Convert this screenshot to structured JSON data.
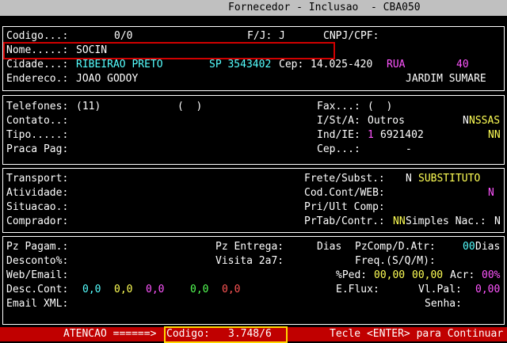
{
  "window": {
    "title": "Fornecedor - Inclusao  - CBA050"
  },
  "section1": {
    "codigo_label": "Codigo...:",
    "codigo_value": "0/0",
    "fj_label": "F/J:",
    "fj_value": "J",
    "cnpj_label": "CNPJ/CPF:",
    "nome_label": "Nome.....:",
    "nome_value": "SOCIN",
    "cidade_label": "Cidade...:",
    "cidade_value": "RIBEIRAO PRETO",
    "uf_code": "SP 3543402",
    "cep_label": "Cep:",
    "cep_value": "14.025-420",
    "logradouro_tipo": "RUA",
    "numero": "40",
    "endereco_label": "Endereco.:",
    "endereco_value": "JOAO GODOY",
    "bairro": "JARDIM SUMARE"
  },
  "section2": {
    "telefones_label": "Telefones:",
    "telefones_value": "(11)",
    "telefones_value2": "(  )",
    "fax_label": "Fax...:",
    "fax_value": "(  )",
    "contato_label": "Contato..:",
    "istA_label": "I/St/A:",
    "istA_value": "Outros",
    "flags_n": "N",
    "flags_nssas": "NSSAS",
    "tipo_label": "Tipo.....:",
    "indie_label": "Ind/IE:",
    "indie_ind": "1",
    "indie_value": "6921402",
    "flags_nn": "NN",
    "praca_label": "Praca Pag:",
    "cep2_label": "Cep...:",
    "cep2_value": "-"
  },
  "section3": {
    "transport_label": "Transport:",
    "frete_label": "Frete/Subst.:",
    "frete_n": "N",
    "frete_value": "SUBSTITUTO",
    "atividade_label": "Atividade:",
    "codcont_label": "Cod.Cont/WEB:",
    "codcont_value": "N",
    "situacao_label": "Situacao.:",
    "priult_label": "Pri/Ult Comp:",
    "comprador_label": "Comprador:",
    "prtab_label": "PrTab/Contr.:",
    "prtab_nn": "NN",
    "simples_label": "Simples Nac.:",
    "simples_value": "N"
  },
  "section4": {
    "pzpagam_label": "Pz Pagam.:",
    "pzentrega_label": "Pz Entrega:",
    "dias_label": "Dias",
    "pzcomp_label": "PzComp/D.Atr:",
    "pzcomp_value": "00",
    "dias2_label": "Dias",
    "desconto_label": "Desconto%:",
    "visita_label": "Visita 2a7:",
    "freq_label": "Freq.(S/Q/M):",
    "web_label": "Web/Email:",
    "ped_label": "%Ped:",
    "ped_value1": "00,00",
    "ped_value2": "00,00",
    "acr_label": "Acr:",
    "acr_value": "00%",
    "desccont_label": "Desc.Cont:",
    "dc1": "0,0",
    "dc2": "0,0",
    "dc3": "0,0",
    "dc4": "0,0",
    "dc5": "0,0",
    "eflux_label": "E.Flux:",
    "vlpal_label": "Vl.Pal:",
    "vlpal_value": "0,00",
    "emailxml_label": "Email XML:",
    "senha_label": "Senha:"
  },
  "statusbar": {
    "atencao": "ATENCAO ======>",
    "codigo_label": "Codigo:",
    "codigo_value": "3.748/6",
    "hint": "Tecle <ENTER> para Continuar"
  }
}
